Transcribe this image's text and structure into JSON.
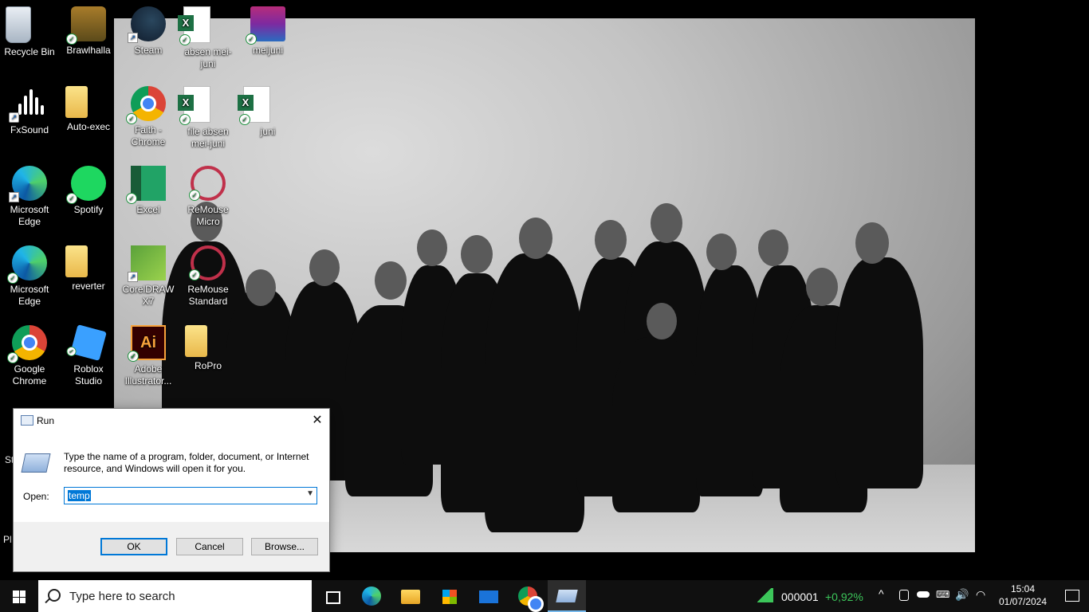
{
  "desktop": {
    "icons": [
      {
        "label": "Recycle Bin"
      },
      {
        "label": "Brawlhalla"
      },
      {
        "label": "Steam"
      },
      {
        "label": "absen mei-juni"
      },
      {
        "label": "meijuni"
      },
      {
        "label": "FxSound"
      },
      {
        "label": "Auto-exec"
      },
      {
        "label": "Faith - Chrome"
      },
      {
        "label": "file absen mei-juni"
      },
      {
        "label": "juni"
      },
      {
        "label": "Microsoft Edge"
      },
      {
        "label": "Spotify"
      },
      {
        "label": "Excel"
      },
      {
        "label": "ReMouse Micro"
      },
      {
        "label": "Microsoft Edge"
      },
      {
        "label": "reverter"
      },
      {
        "label": "CorelDRAW X7"
      },
      {
        "label": "ReMouse Standard"
      },
      {
        "label": "Google Chrome"
      },
      {
        "label": "Roblox Studio"
      },
      {
        "label": "Adobe Illustrator..."
      },
      {
        "label": "RoPro"
      }
    ],
    "partial_labels": {
      "left_1": "St",
      "left_2": "Pl"
    }
  },
  "run_dialog": {
    "title": "Run",
    "description": "Type the name of a program, folder, document, or Internet resource, and Windows will open it for you.",
    "open_label": "Open:",
    "open_value": "temp",
    "ok_label": "OK",
    "cancel_label": "Cancel",
    "browse_label": "Browse..."
  },
  "taskbar": {
    "search_placeholder": "Type here to search",
    "pinned": [
      "task-view-icon",
      "edge-icon",
      "file-explorer-icon",
      "store-icon",
      "mail-icon",
      "chrome-icon",
      "run-icon"
    ],
    "stock": {
      "symbol": "000001",
      "change": "+0,92%",
      "change_color": "#3cc65a"
    },
    "clock": {
      "time": "15:04",
      "date": "01/07/2024"
    }
  }
}
